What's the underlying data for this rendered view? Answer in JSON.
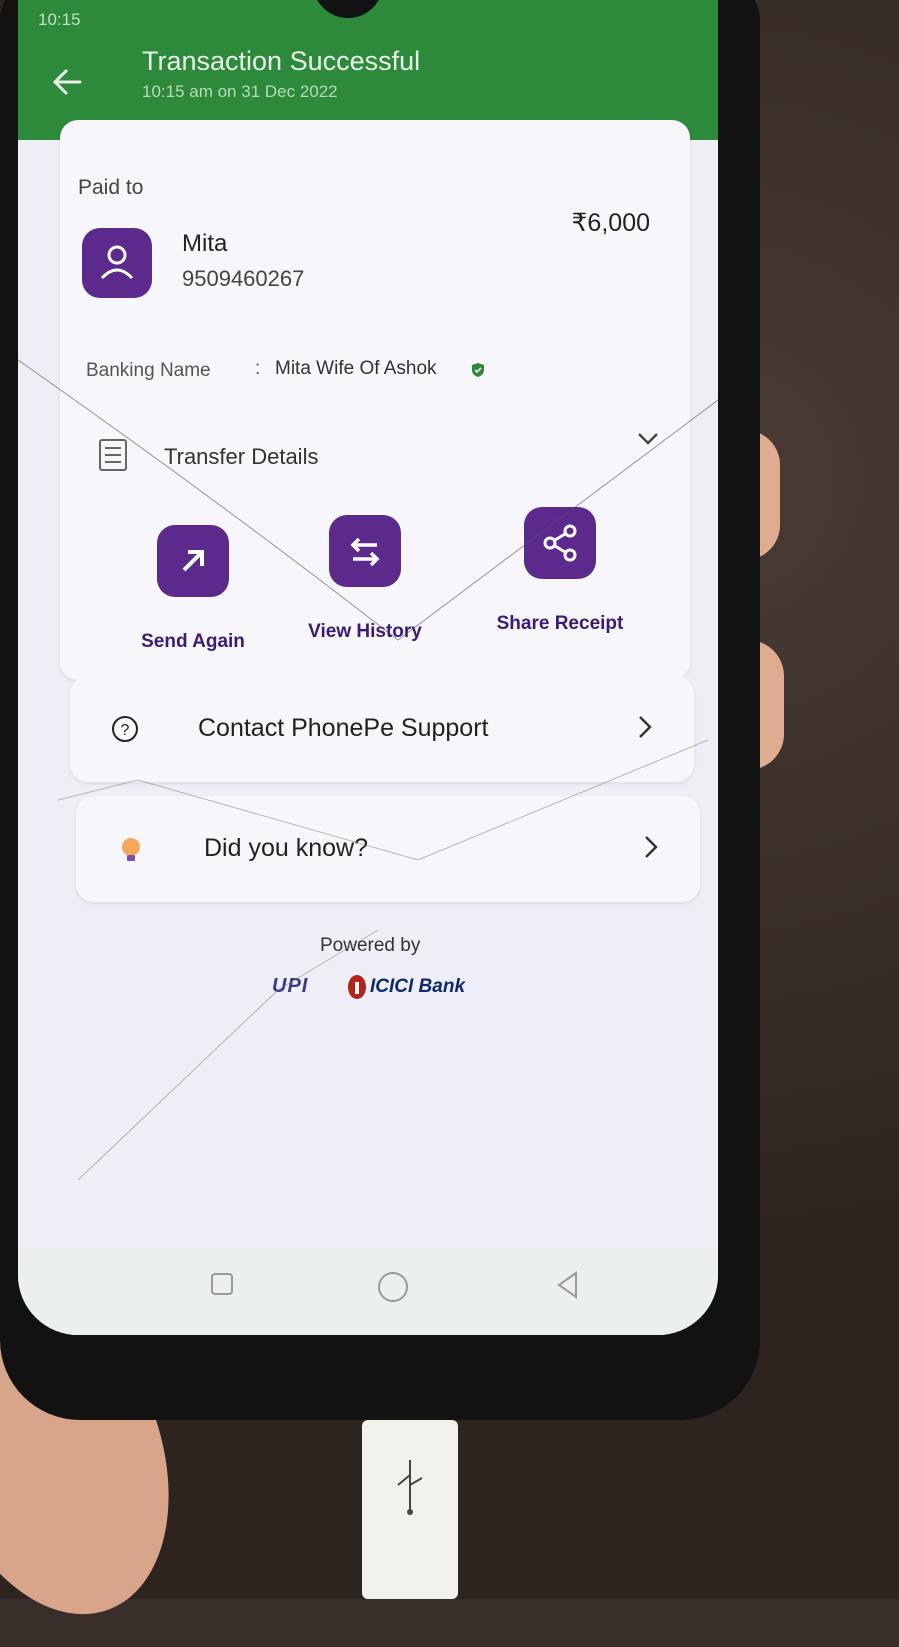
{
  "status_bar": {
    "time": "10:15"
  },
  "header": {
    "title": "Transaction Successful",
    "subtitle": "10:15 am on 31 Dec 2022",
    "color": "#2c8a3a"
  },
  "payment": {
    "paid_to_label": "Paid to",
    "payee_name": "Mita",
    "payee_phone": "9509460267",
    "amount": "₹6,000",
    "banking_name_label": "Banking Name",
    "banking_name_separator": ":",
    "banking_name_value": "Mita Wife Of Ashok",
    "transfer_details_label": "Transfer Details"
  },
  "actions": [
    {
      "label": "Send Again",
      "icon": "arrow-up-right-icon"
    },
    {
      "label": "View History",
      "icon": "swap-arrows-icon"
    },
    {
      "label": "Share Receipt",
      "icon": "share-icon"
    }
  ],
  "support": {
    "label": "Contact PhonePe Support",
    "icon": "question-icon"
  },
  "did_you_know": {
    "label": "Did you know?",
    "icon": "lightbulb-icon"
  },
  "footer": {
    "powered_by": "Powered by",
    "upi_logo_text": "UPI",
    "bank_name": "ICICI Bank"
  },
  "accent_color": "#5b2a8c"
}
